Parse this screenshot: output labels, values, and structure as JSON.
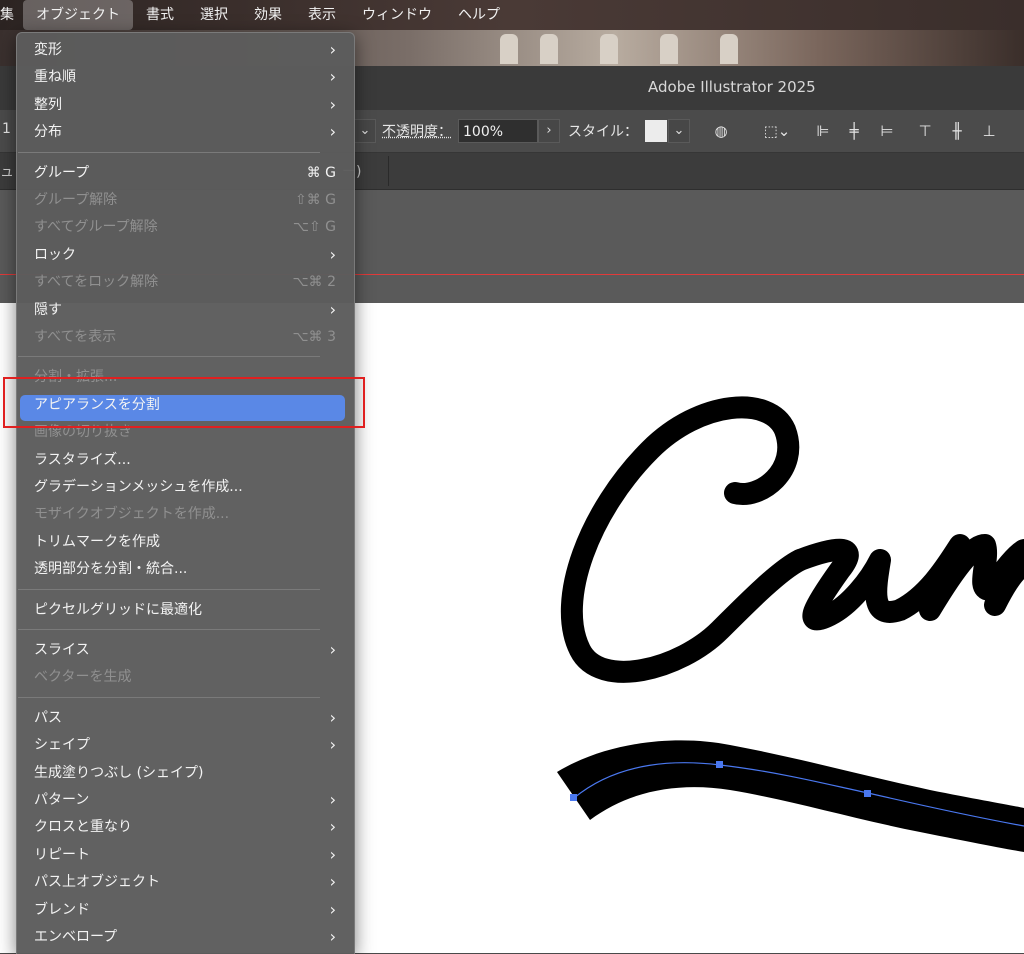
{
  "menubar": {
    "items": [
      "集",
      "オブジェクト",
      "書式",
      "選択",
      "効果",
      "表示",
      "ウィンドウ",
      "ヘルプ"
    ],
    "active_index": 1
  },
  "app": {
    "title": "Adobe Illustrator 2025"
  },
  "control_bar": {
    "partial_left": "1",
    "opacity_label": "不透明度：",
    "opacity_value": "100%",
    "style_label": "スタイル："
  },
  "tab_bar": {
    "partial_tab": "ー)",
    "partial_left": "ュ"
  },
  "object_menu": {
    "items": [
      {
        "label": "変形",
        "submenu": true,
        "enabled": true
      },
      {
        "label": "重ね順",
        "submenu": true,
        "enabled": true
      },
      {
        "label": "整列",
        "submenu": true,
        "enabled": true
      },
      {
        "label": "分布",
        "submenu": true,
        "enabled": true
      },
      {
        "separator": true
      },
      {
        "label": "グループ",
        "shortcut": "⌘ G",
        "enabled": true
      },
      {
        "label": "グループ解除",
        "shortcut": "⇧⌘ G",
        "enabled": false
      },
      {
        "label": "すべてグループ解除",
        "shortcut": "⌥⇧ G",
        "enabled": false
      },
      {
        "label": "ロック",
        "submenu": true,
        "enabled": true
      },
      {
        "label": "すべてをロック解除",
        "shortcut": "⌥⌘ 2",
        "enabled": false
      },
      {
        "label": "隠す",
        "submenu": true,
        "enabled": true
      },
      {
        "label": "すべてを表示",
        "shortcut": "⌥⌘ 3",
        "enabled": false
      },
      {
        "separator": true
      },
      {
        "label": "分割・拡張...",
        "enabled": false
      },
      {
        "label": "アピアランスを分割",
        "enabled": true,
        "highlighted": true
      },
      {
        "label": "画像の切り抜き",
        "enabled": false
      },
      {
        "label": "ラスタライズ...",
        "enabled": true
      },
      {
        "label": "グラデーションメッシュを作成...",
        "enabled": true
      },
      {
        "label": "モザイクオブジェクトを作成...",
        "enabled": false
      },
      {
        "label": "トリムマークを作成",
        "enabled": true
      },
      {
        "label": "透明部分を分割・統合...",
        "enabled": true
      },
      {
        "separator": true
      },
      {
        "label": "ピクセルグリッドに最適化",
        "enabled": true
      },
      {
        "separator": true
      },
      {
        "label": "スライス",
        "submenu": true,
        "enabled": true
      },
      {
        "label": "ベクターを生成",
        "enabled": false
      },
      {
        "separator": true
      },
      {
        "label": "パス",
        "submenu": true,
        "enabled": true
      },
      {
        "label": "シェイプ",
        "submenu": true,
        "enabled": true
      },
      {
        "label": "生成塗りつぶし (シェイプ)",
        "enabled": true
      },
      {
        "label": "パターン",
        "submenu": true,
        "enabled": true
      },
      {
        "label": "クロスと重なり",
        "submenu": true,
        "enabled": true
      },
      {
        "label": "リピート",
        "submenu": true,
        "enabled": true
      },
      {
        "label": "パス上オブジェクト",
        "submenu": true,
        "enabled": true
      },
      {
        "label": "ブレンド",
        "submenu": true,
        "enabled": true
      },
      {
        "label": "エンベロープ",
        "submenu": true,
        "enabled": true
      }
    ]
  },
  "colors": {
    "highlight": "#5a88e6",
    "callout": "#e02020",
    "path_selection": "#4a78f0"
  }
}
